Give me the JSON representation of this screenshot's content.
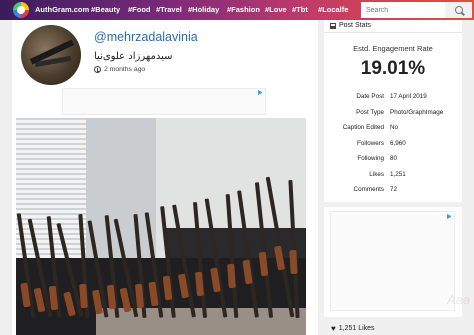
{
  "header": {
    "brand": "AuthGram.com",
    "nav": [
      "#Beauty",
      "#Food",
      "#Travel",
      "#Holiday",
      "#Fashion",
      "#Love",
      "#Tbt",
      "#Localfe"
    ],
    "search_placeholder": "Search"
  },
  "post": {
    "username": "@mehrzadalavinia",
    "full_name": "سیدمهرزاد علوی‌نیا",
    "time_ago": "2 months ago"
  },
  "stats": {
    "heading": "Post Stats",
    "engagement_label": "Estd. Engagement Rate",
    "engagement_value": "19.01%",
    "rows": [
      {
        "key": "Date Post",
        "value": "17 April 2019"
      },
      {
        "key": "Post Type",
        "value": "Photo/GraphImage"
      },
      {
        "key": "Caption Edited",
        "value": "No"
      },
      {
        "key": "Followers",
        "value": "6,960"
      },
      {
        "key": "Following",
        "value": "80"
      },
      {
        "key": "Likes",
        "value": "1,251"
      },
      {
        "key": "Comments",
        "value": "72"
      }
    ]
  },
  "likes_footer": "1,251 Likes"
}
